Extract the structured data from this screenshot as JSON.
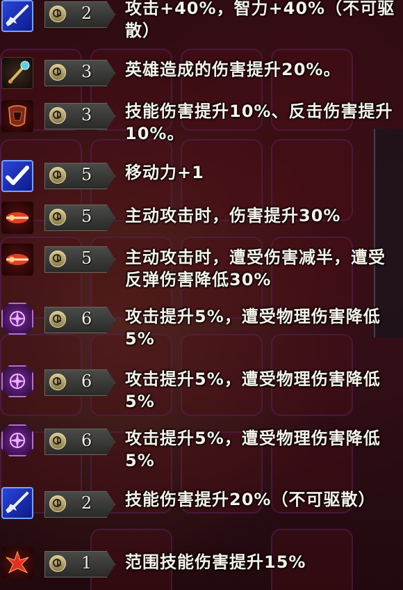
{
  "buffs": [
    {
      "icon": "sword-icon",
      "turns": "2",
      "text": "攻击+40%，智力+40%（不可驱散）"
    },
    {
      "icon": "scepter-icon",
      "turns": "3",
      "text": "英雄造成的伤害提升20%。"
    },
    {
      "icon": "armor-icon",
      "turns": "3",
      "text": "技能伤害提升10%、反击伤害提升10%。"
    },
    {
      "icon": "boot-icon",
      "turns": "5",
      "text": "移动力+1"
    },
    {
      "icon": "flame-sword-icon",
      "turns": "5",
      "text": "主动攻击时，伤害提升30%"
    },
    {
      "icon": "flame-sword-icon",
      "turns": "5",
      "text": "主动攻击时，遭受伤害减半，遭受反弹伤害降低30%"
    },
    {
      "icon": "rune-icon",
      "turns": "6",
      "text": "攻击提升5%，遭受物理伤害降低5%"
    },
    {
      "icon": "rune-icon",
      "turns": "6",
      "text": "攻击提升5%，遭受物理伤害降低5%"
    },
    {
      "icon": "rune-icon",
      "turns": "6",
      "text": "攻击提升5%，遭受物理伤害降低5%"
    },
    {
      "icon": "sword-icon",
      "turns": "2",
      "text": "技能伤害提升20%（不可驱散）"
    },
    {
      "icon": "fire-burst-icon",
      "turns": "1",
      "text": "范围技能伤害提升15%"
    }
  ]
}
